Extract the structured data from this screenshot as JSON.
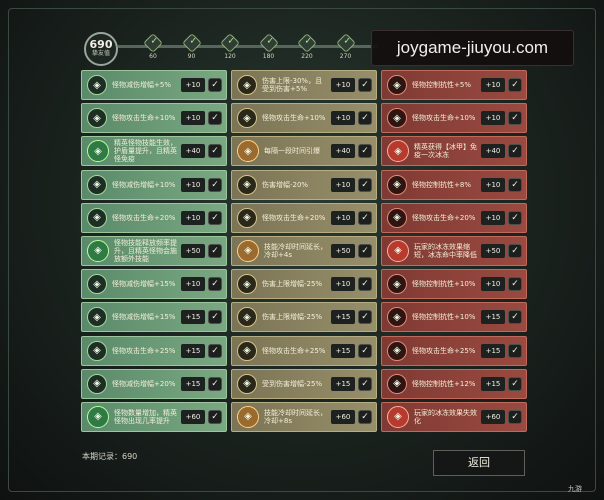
{
  "score": {
    "value": "690",
    "label": "挚友值"
  },
  "milestones": [
    "60",
    "90",
    "120",
    "180",
    "220",
    "270"
  ],
  "watermark": "joygame-jiuyou.com",
  "columns": {
    "green": [
      {
        "text": "怪物减伤增幅+5%",
        "points": "+10"
      },
      {
        "text": "怪物攻击生命+10%",
        "points": "+10"
      },
      {
        "text": "精英怪物技能生效，护盾量提升，且精英怪免疫",
        "points": "+40"
      },
      {
        "text": "怪物减伤增幅+10%",
        "points": "+10"
      },
      {
        "text": "怪物攻击生命+20%",
        "points": "+10"
      },
      {
        "text": "怪物技能释放频率提升，且精英怪物会施放额外技能",
        "points": "+50"
      },
      {
        "text": "怪物减伤增幅+15%",
        "points": "+10"
      },
      {
        "text": "怪物减伤增幅+15%",
        "points": "+15"
      },
      {
        "text": "怪物攻击生命+25%",
        "points": "+15"
      },
      {
        "text": "怪物减伤增幅+20%",
        "points": "+15"
      },
      {
        "text": "怪物数量增加，精英怪物出现几率提升",
        "points": "+60"
      }
    ],
    "gold": [
      {
        "text": "伤害上限-30%，且受到伤害+5%",
        "points": "+10"
      },
      {
        "text": "怪物攻击生命+10%",
        "points": "+10"
      },
      {
        "text": "每隔一段时间引爆",
        "points": "+40"
      },
      {
        "text": "伤害增幅-20%",
        "points": "+10"
      },
      {
        "text": "怪物攻击生命+20%",
        "points": "+10"
      },
      {
        "text": "技能冷却时间延长，冷却+4s",
        "points": "+50"
      },
      {
        "text": "伤害上限增幅-25%",
        "points": "+10"
      },
      {
        "text": "伤害上限增幅-25%",
        "points": "+15"
      },
      {
        "text": "怪物攻击生命+25%",
        "points": "+15"
      },
      {
        "text": "受到伤害增幅-25%",
        "points": "+15"
      },
      {
        "text": "技能冷却时间延长，冷却+8s",
        "points": "+60"
      }
    ],
    "red": [
      {
        "text": "怪物控制抗性+5%",
        "points": "+10"
      },
      {
        "text": "怪物攻击生命+10%",
        "points": "+10"
      },
      {
        "text": "精英获得【冰甲】免疫一次冰冻",
        "points": "+40"
      },
      {
        "text": "怪物控制抗性+8%",
        "points": "+10"
      },
      {
        "text": "怪物攻击生命+20%",
        "points": "+10"
      },
      {
        "text": "玩家的冰冻效果缩短，冰冻命中率降低",
        "points": "+50"
      },
      {
        "text": "怪物控制抗性+10%",
        "points": "+10"
      },
      {
        "text": "怪物控制抗性+10%",
        "points": "+15"
      },
      {
        "text": "怪物攻击生命+25%",
        "points": "+15"
      },
      {
        "text": "怪物控制抗性+12%",
        "points": "+15"
      },
      {
        "text": "玩家的冰冻效果失效化",
        "points": "+60"
      }
    ]
  },
  "special_rows": [
    2,
    5,
    10
  ],
  "footer": {
    "record": "本期记录：690",
    "return_label": "返回",
    "logo": "九游"
  },
  "colors": {
    "green": "#7aa882",
    "gold": "#978f6a",
    "red": "#9a4a40"
  }
}
